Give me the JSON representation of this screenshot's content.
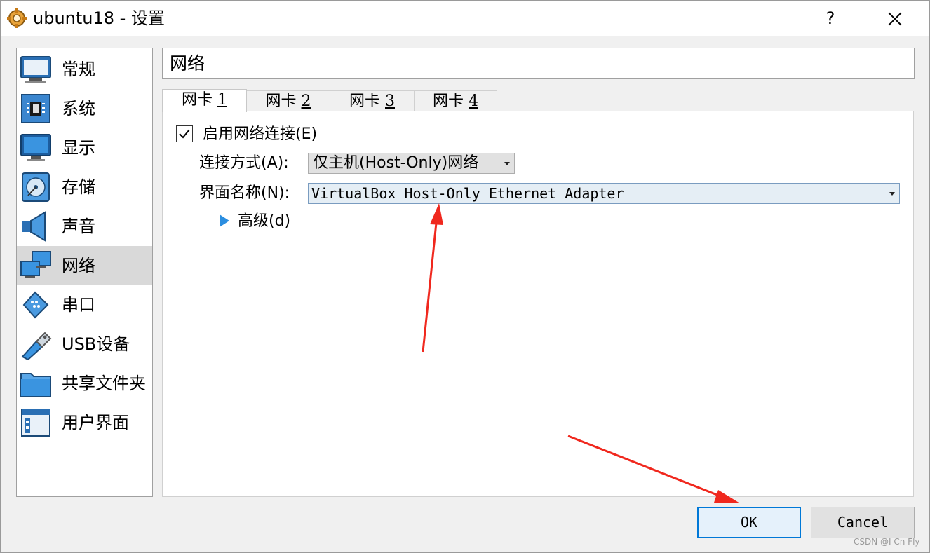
{
  "window": {
    "title": "ubuntu18 - 设置",
    "help_label": "?",
    "close_label": "✕",
    "icon": "gear-icon"
  },
  "sidebar": {
    "items": [
      {
        "label": "常规",
        "icon": "monitor-icon"
      },
      {
        "label": "系统",
        "icon": "chip-icon"
      },
      {
        "label": "显示",
        "icon": "display-icon"
      },
      {
        "label": "存储",
        "icon": "disk-icon"
      },
      {
        "label": "声音",
        "icon": "speaker-icon"
      },
      {
        "label": "网络",
        "icon": "network-icon",
        "selected": true
      },
      {
        "label": "串口",
        "icon": "serial-port-icon"
      },
      {
        "label": "USB设备",
        "icon": "usb-icon"
      },
      {
        "label": "共享文件夹",
        "icon": "folder-icon"
      },
      {
        "label": "用户界面",
        "icon": "window-ui-icon"
      }
    ]
  },
  "page": {
    "title": "网络"
  },
  "tabs": [
    {
      "label": "网卡",
      "num": "1",
      "active": true
    },
    {
      "label": "网卡",
      "num": "2"
    },
    {
      "label": "网卡",
      "num": "3"
    },
    {
      "label": "网卡",
      "num": "4"
    }
  ],
  "adapter": {
    "enable_label": "启用网络连接(E)",
    "enable_checked": true,
    "attached_label": "连接方式(A):",
    "attached_value": "仅主机(Host-Only)网络",
    "name_label": "界面名称(N):",
    "name_value": "VirtualBox Host-Only Ethernet Adapter",
    "advanced_label": "高级(d)"
  },
  "buttons": {
    "ok": "OK",
    "cancel": "Cancel"
  },
  "annotations": {
    "arrow_color": "#f0281e"
  },
  "watermark": "CSDN @I Cn Fly"
}
